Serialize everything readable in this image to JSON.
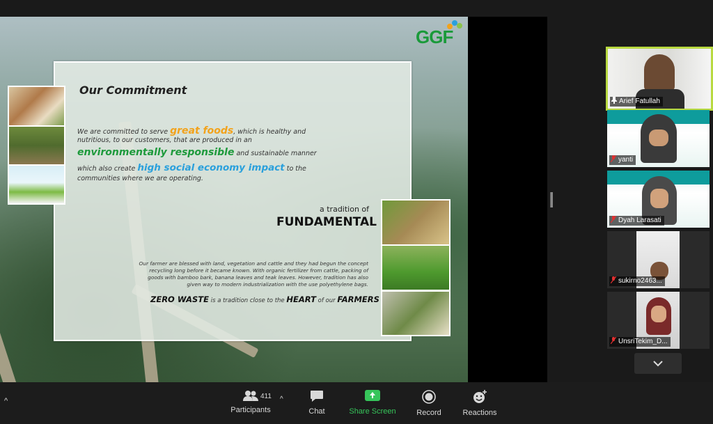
{
  "slide": {
    "logo": "GGF",
    "commitment_title": "Our Commitment",
    "para": {
      "l1a": "We are committed to serve ",
      "l1b": "great foods",
      "l1c": ", which is healthy and",
      "l2": "nutritious, to our customers, that are produced in an",
      "l3a": "environmentally responsible",
      "l3b": " and sustainable manner",
      "l4a": "which also create ",
      "l4b": "high social economy impact",
      "l4c": " to the",
      "l5": "communities where we are operating."
    },
    "tradition_of": "a tradition of",
    "fundamental": "FUNDAMENTAL",
    "farmer_text": [
      "Our farmer are blessed with land, vegetation and cattle and they had begun the concept",
      "recycling long before it became known. With organic fertilizer from cattle, packing of",
      "goods with bamboo bark, banana leaves and teak leaves. However, tradition has also",
      "given way to modern industrialization with the use polyethylene bags."
    ],
    "zero_waste": {
      "a": "ZERO WASTE",
      "b": " is a tradition close to the ",
      "c": "HEART",
      "d": " of our ",
      "e": "FARMERS"
    }
  },
  "participants_panel": [
    {
      "name": "Arief Fatullah",
      "active": true
    },
    {
      "name": "yanti",
      "active": false
    },
    {
      "name": "Dyah Larasati",
      "active": false
    },
    {
      "name": "sukirno2463...",
      "active": false
    },
    {
      "name": "UnsriTekim_D...",
      "active": false
    }
  ],
  "toolbar": {
    "participants_count": "411",
    "participants_label": "Participants",
    "chat_label": "Chat",
    "share_label": "Share Screen",
    "record_label": "Record",
    "reactions_label": "Reactions"
  },
  "colors": {
    "share_accent": "#36c55a",
    "active_speaker": "#b8d940",
    "brand_green": "#1a9a3a"
  }
}
